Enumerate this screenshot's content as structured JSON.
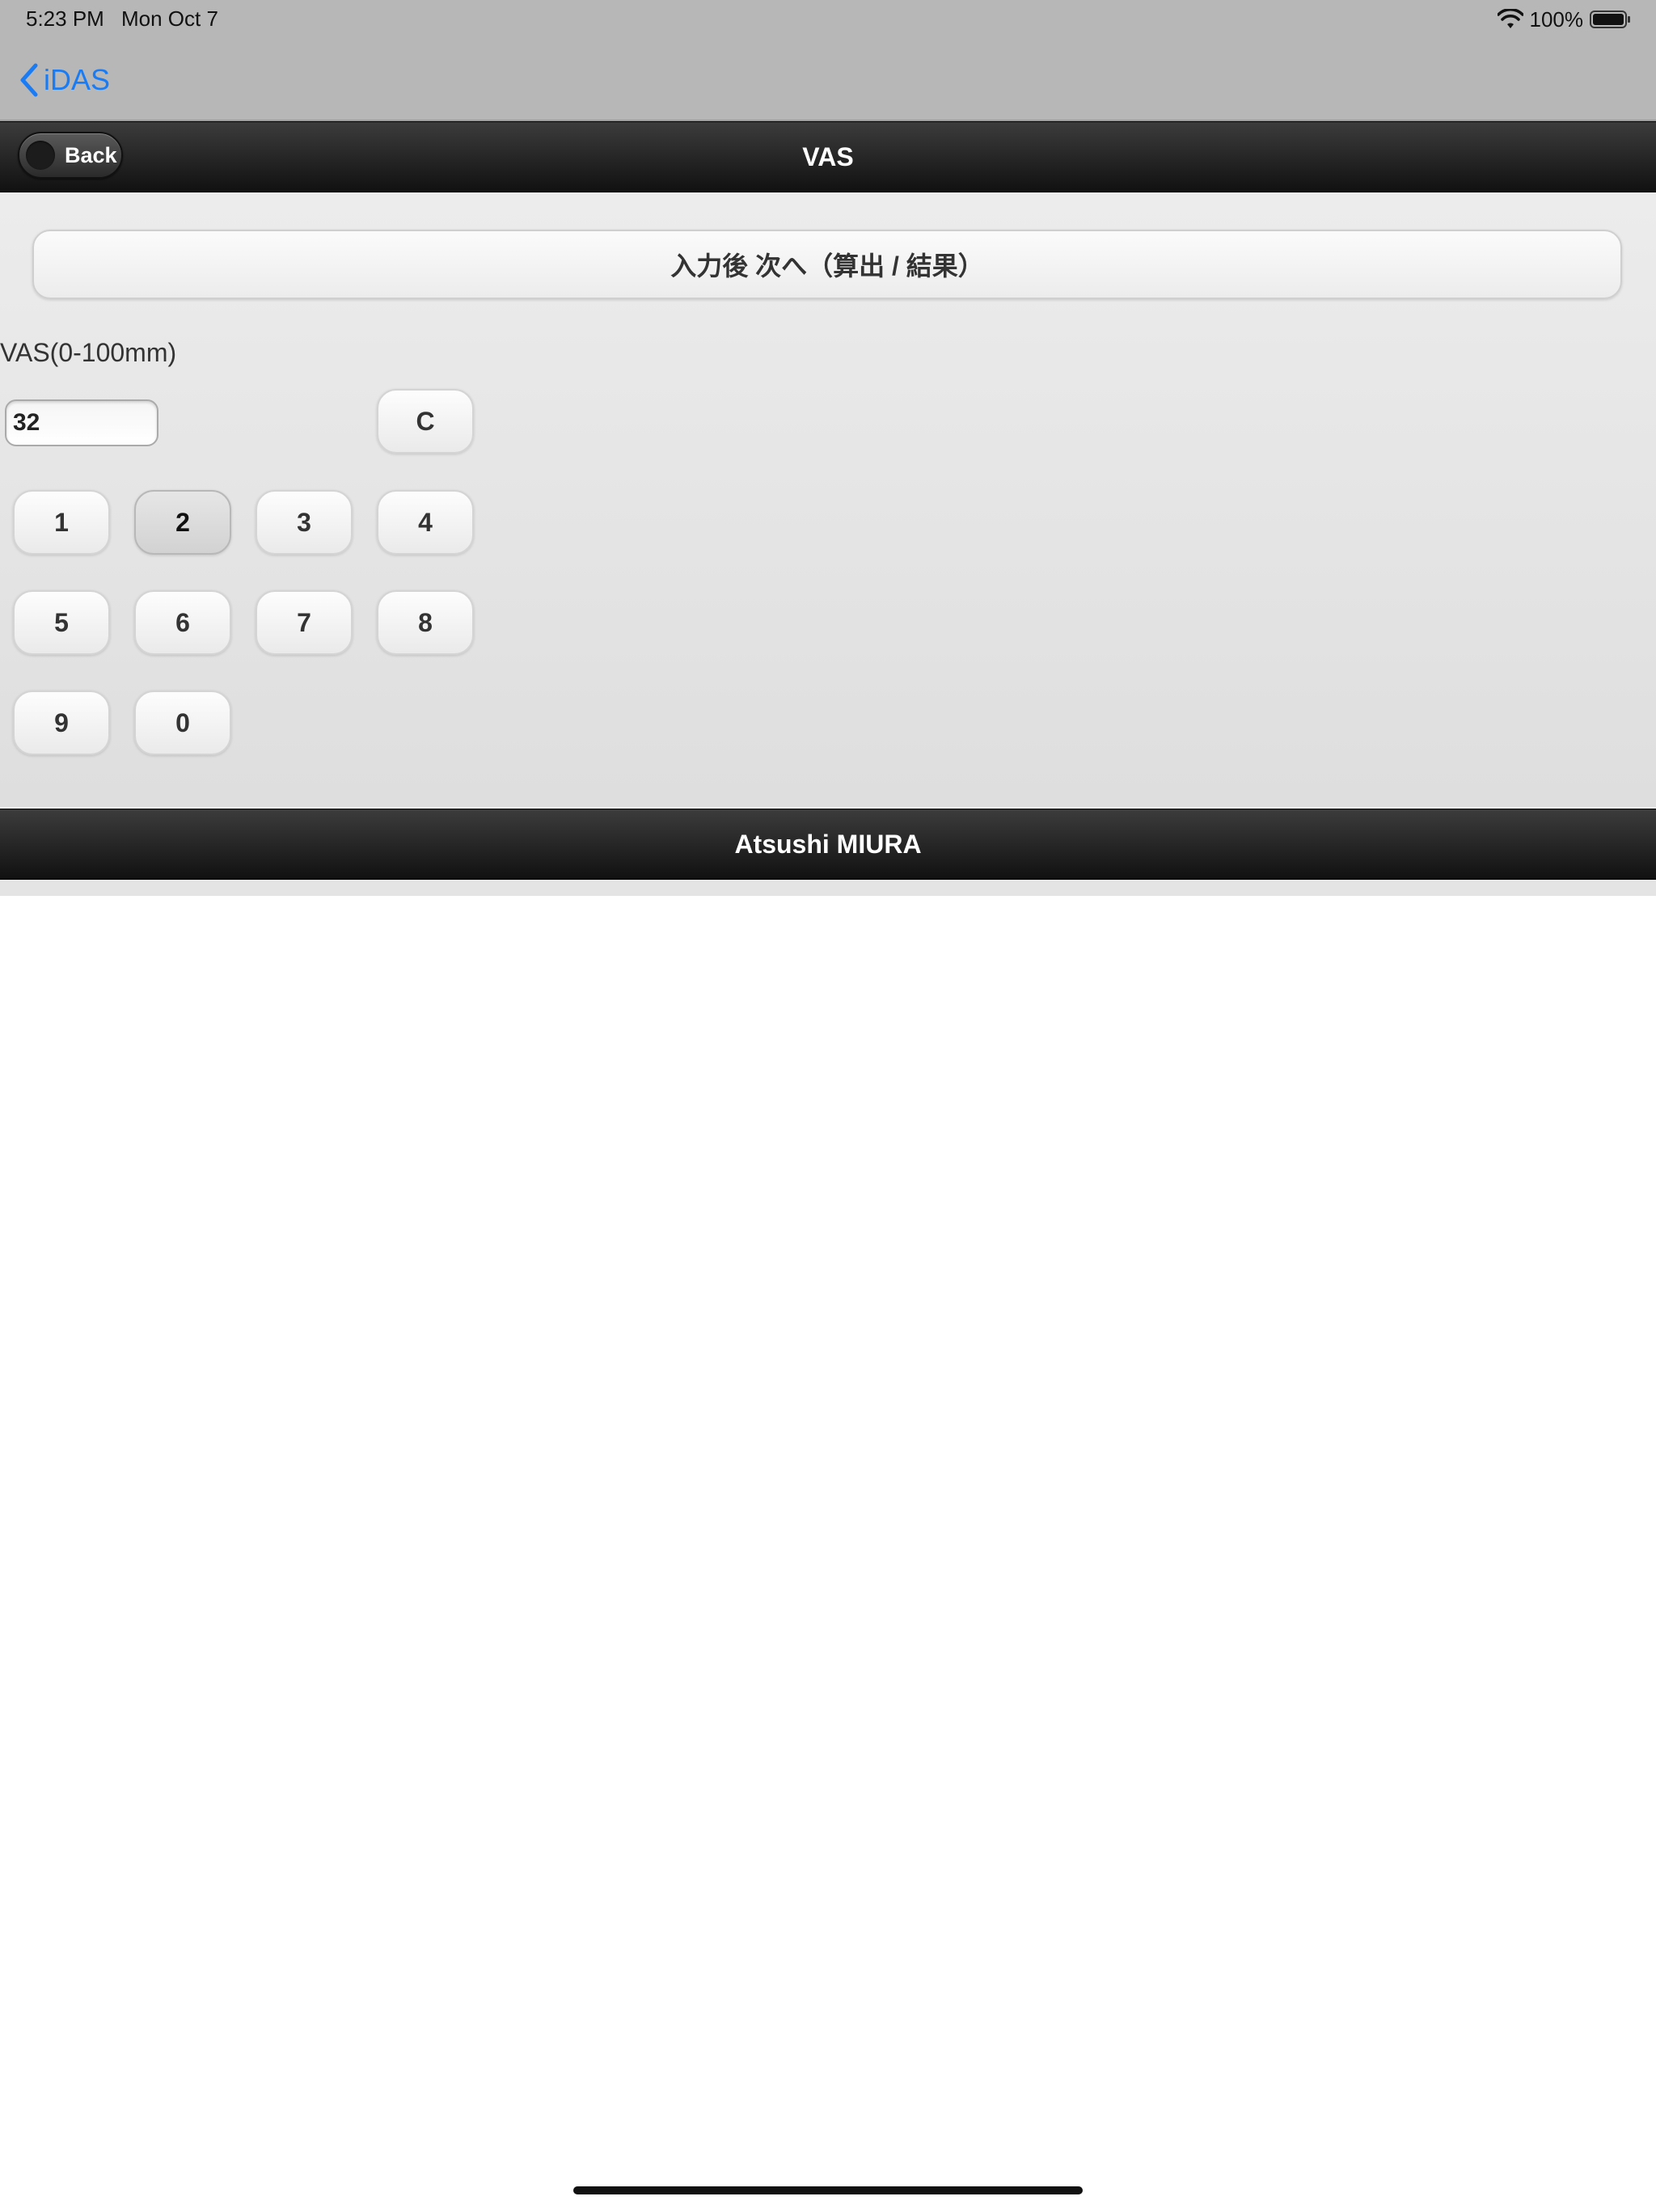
{
  "status_bar": {
    "time": "5:23 PM",
    "date": "Mon Oct 7",
    "battery": "100%"
  },
  "ios_nav": {
    "back_label": "iDAS"
  },
  "header": {
    "title": "VAS",
    "back_label": "Back"
  },
  "form": {
    "next_label": "入力後 次へ（算出 / 結果）",
    "field_label": "VAS(0-100mm)",
    "value": "32"
  },
  "keypad": {
    "clear": "C",
    "k1": "1",
    "k2": "2",
    "k3": "3",
    "k4": "4",
    "k5": "5",
    "k6": "6",
    "k7": "7",
    "k8": "8",
    "k9": "9",
    "k0": "0",
    "active_key": "2"
  },
  "footer": {
    "text": "Atsushi MIURA"
  },
  "colors": {
    "ios_link": "#1a7cf5",
    "bar_dark": "#111111"
  }
}
